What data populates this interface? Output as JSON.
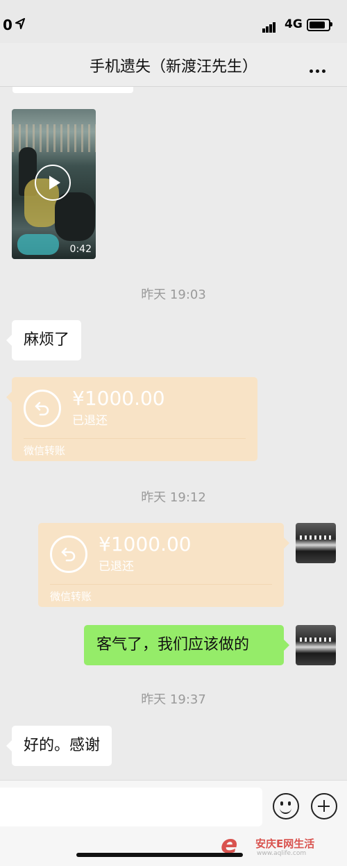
{
  "status_bar": {
    "time": "0",
    "network": "4G",
    "battery_level": 0.85
  },
  "nav": {
    "title": "手机遗失（新渡汪先生）"
  },
  "messages": {
    "video": {
      "duration": "0:42"
    },
    "time1": "昨天 19:03",
    "msg1": "麻烦了",
    "transfer1": {
      "amount": "¥1000.00",
      "status": "已退还",
      "label": "微信转账"
    },
    "time2": "昨天 19:12",
    "transfer2": {
      "amount": "¥1000.00",
      "status": "已退还",
      "label": "微信转账"
    },
    "msg2": "客气了，我们应该做的",
    "time3": "昨天 19:37",
    "msg3": "好的。感谢"
  },
  "input_bar": {
    "value": ""
  },
  "watermark": {
    "logo": "e",
    "text": "安庆E网生活",
    "sub": "www.aqlife.com"
  },
  "colors": {
    "sent_bubble": "#95ec69",
    "received_bubble": "#ffffff",
    "transfer_bubble": "#f8e3c6",
    "background": "#ebebeb"
  },
  "icons": [
    "location-arrow-icon",
    "signal-icon",
    "battery-icon",
    "more-icon",
    "play-icon",
    "transfer-return-icon",
    "emoji-icon",
    "plus-icon"
  ]
}
